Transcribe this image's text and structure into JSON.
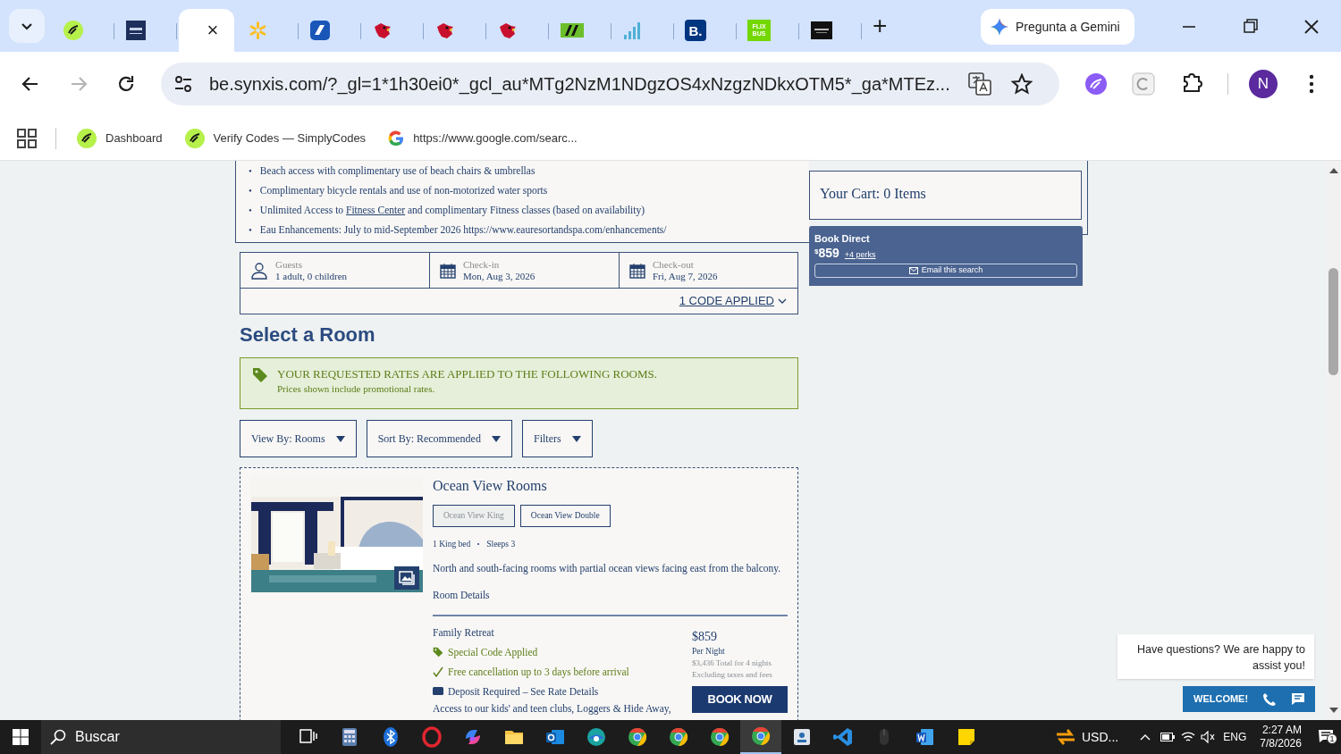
{
  "browser": {
    "tabs": [
      {
        "kind": "pen",
        "selected": false
      },
      {
        "kind": "square-navy",
        "selected": false
      },
      {
        "kind": "blank",
        "selected": true,
        "close": "×"
      },
      {
        "kind": "spark",
        "selected": false
      },
      {
        "kind": "wing",
        "selected": false
      },
      {
        "kind": "bird",
        "selected": false
      },
      {
        "kind": "bird",
        "selected": false
      },
      {
        "kind": "bird",
        "selected": false
      },
      {
        "kind": "stripes",
        "selected": false
      },
      {
        "kind": "bars",
        "selected": false
      },
      {
        "kind": "letter-blue",
        "badge": "B.",
        "selected": false
      },
      {
        "kind": "letter-green",
        "badge": "FLIX BUS",
        "selected": false
      },
      {
        "kind": "square-dark",
        "selected": false
      }
    ],
    "new_tab": "+",
    "gemini": "Pregunta a Gemini",
    "nav": [
      {
        "kind": "back",
        "disabled": false
      },
      {
        "kind": "forward",
        "disabled": true
      },
      {
        "kind": "reload",
        "disabled": false
      }
    ],
    "url": "be.synxis.com/?_gl=1*1h30ei0*_gcl_au*MTg2NzM1NDgzOS4xNzgzNDkxOTM5*_ga*MTEz...",
    "avatar": "N",
    "bookmarks": [
      {
        "kind": "pen",
        "label": "Dashboard"
      },
      {
        "kind": "pen",
        "label": "Verify Codes — SimplyCodes"
      },
      {
        "kind": "google",
        "label": "https://www.google.com/searc..."
      }
    ]
  },
  "page": {
    "benefits": [
      {
        "marker": "•",
        "parts": [
          {
            "text": "Beach access with complimentary use of beach chairs & umbrellas",
            "link": false
          }
        ]
      },
      {
        "marker": "•",
        "parts": [
          {
            "text": "Complimentary bicycle rentals and use of non-motorized water sports",
            "link": false
          }
        ]
      },
      {
        "marker": "•",
        "parts": [
          {
            "text": "Unlimited Access to ",
            "link": false
          },
          {
            "text": "Fitness Center",
            "link": true
          },
          {
            "text": " and complimentary Fitness classes (based on availability)",
            "link": false
          }
        ]
      },
      {
        "marker": "•",
        "parts": [
          {
            "text": "Eau Enhancements: July to mid-September 2026 https://www.eauresortandspa.com/enhancements/",
            "link": false
          }
        ]
      }
    ],
    "summary": {
      "fields": [
        {
          "kind": "guests",
          "label": "Guests",
          "value": "1 adult, 0 children"
        },
        {
          "kind": "date",
          "label": "Check-in",
          "value": "Mon, Aug 3, 2026"
        },
        {
          "kind": "date",
          "label": "Check-out",
          "value": "Fri, Aug 7, 2026"
        }
      ],
      "codes_link": "1 CODE APPLIED"
    },
    "heading": "Select a Room",
    "alert": {
      "title": "YOUR REQUESTED RATES ARE APPLIED TO THE FOLLOWING ROOMS.",
      "text": "Prices shown include promotional rates."
    },
    "controls": [
      "View By: Rooms",
      "Sort By: Recommended",
      "Filters"
    ],
    "room": {
      "title": "Ocean View Rooms",
      "types": [
        {
          "label": "Ocean View King",
          "selected": true
        },
        {
          "label": "Ocean View Double",
          "selected": false
        }
      ],
      "specs": [
        "1 King bed",
        "Sleeps 3"
      ],
      "description": "North and south-facing rooms with partial ocean views facing east from the balcony.",
      "details_link": "Room Details",
      "rate": {
        "name": "Family Retreat",
        "features": [
          {
            "kind": "code",
            "text": "Special Code Applied"
          },
          {
            "kind": "cancel",
            "text": "Free cancellation up to 3 days before arrival"
          },
          {
            "kind": "deposit",
            "text": "Deposit Required – See Rate Details"
          }
        ],
        "description": "Access to our kids' and teen clubs, Loggers & Hide Away,",
        "price": "$859",
        "per": "Per Night",
        "total": "$3,436 Total for 4 nights",
        "note": "Excluding taxes and fees",
        "book": "BOOK NOW"
      }
    },
    "cart": {
      "title": "Your Cart: 0 Items"
    },
    "book_direct": {
      "title": "Book Direct",
      "currency": "$",
      "price": "859",
      "perks": "+4 perks",
      "email": "Email this search"
    },
    "chat": {
      "message": "Have questions? We are happy to assist you!",
      "button": "WELCOME!"
    }
  },
  "taskbar": {
    "search": "Buscar",
    "apps": [
      {
        "kind": "taskview",
        "selected": false
      },
      {
        "kind": "calculator",
        "selected": false
      },
      {
        "kind": "bluetooth",
        "selected": false
      },
      {
        "kind": "ring",
        "selected": false
      },
      {
        "kind": "copilot",
        "selected": false
      },
      {
        "kind": "folder",
        "selected": false
      },
      {
        "kind": "mail",
        "selected": false
      },
      {
        "kind": "globe",
        "selected": false
      },
      {
        "kind": "chrome",
        "selected": false
      },
      {
        "kind": "chrome",
        "selected": false
      },
      {
        "kind": "chrome",
        "selected": false
      },
      {
        "kind": "chrome",
        "selected": true
      },
      {
        "kind": "contact",
        "selected": false
      },
      {
        "kind": "code",
        "selected": false
      },
      {
        "kind": "mouse",
        "selected": false
      },
      {
        "kind": "word",
        "selected": false
      },
      {
        "kind": "note",
        "selected": false
      }
    ],
    "tray": {
      "currency": "USD...",
      "language": "ENG",
      "time": "2:27 AM",
      "date": "7/8/2026",
      "notifications": "1"
    }
  }
}
